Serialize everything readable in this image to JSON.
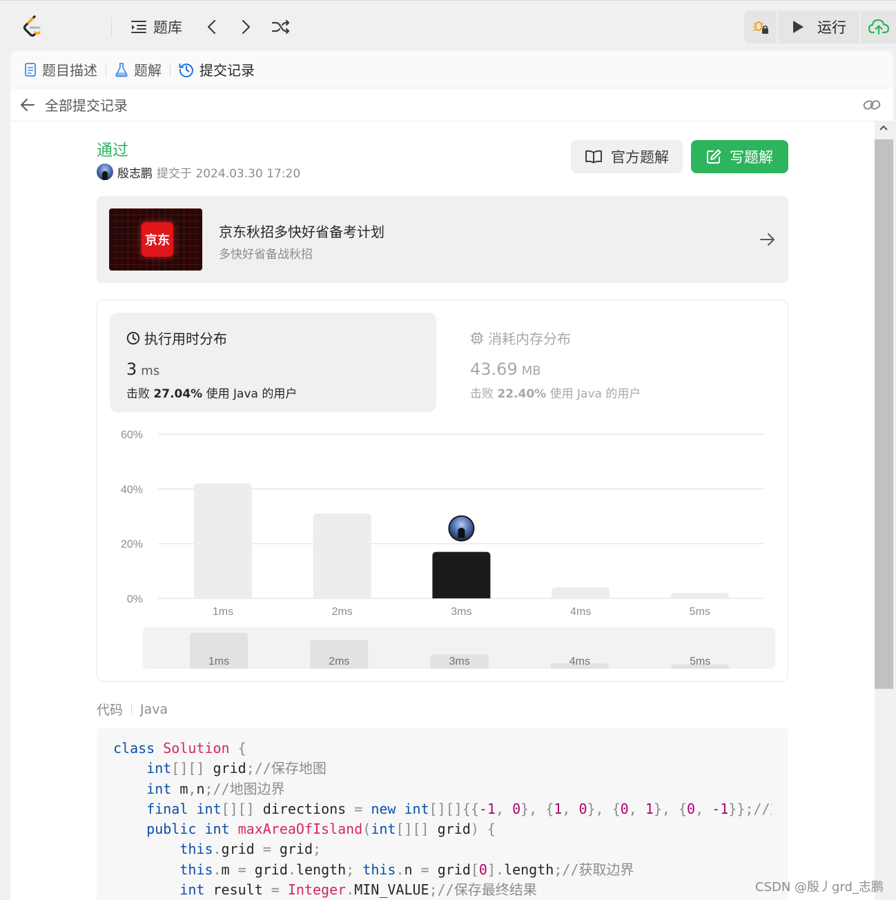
{
  "topbar": {
    "problem_bank_label": "题库",
    "run_label": "运行"
  },
  "tabs": [
    {
      "label": "题目描述"
    },
    {
      "label": "题解"
    },
    {
      "label": "提交记录"
    }
  ],
  "back_label": "全部提交记录",
  "submission": {
    "status": "通过",
    "username": "殷志鹏",
    "submitted_at": "提交于 2024.03.30 17:20"
  },
  "buttons": {
    "official_solution": "官方题解",
    "write_solution": "写题解"
  },
  "ad": {
    "badge": "京东",
    "title": "京东秋招多快好省备考计划",
    "subtitle": "多快好省备战秋招"
  },
  "runtime": {
    "title": "执行用时分布",
    "value": "3",
    "unit": "ms",
    "beat_prefix": "击败",
    "beat_pct": "27.04%",
    "beat_suffix": "使用 Java 的用户"
  },
  "memory": {
    "title": "消耗内存分布",
    "value": "43.69",
    "unit": "MB",
    "beat_prefix": "击败",
    "beat_pct": "22.40%",
    "beat_suffix": "使用 Java 的用户"
  },
  "chart_data": {
    "type": "bar",
    "categories": [
      "1ms",
      "2ms",
      "3ms",
      "4ms",
      "5ms"
    ],
    "values": [
      42,
      31,
      17,
      4,
      2
    ],
    "y_ticks": [
      "60%",
      "40%",
      "20%",
      "0%"
    ],
    "ylim": [
      0,
      60
    ],
    "highlight_index": 2,
    "grid": true,
    "colors": {
      "bar": "#ededed",
      "highlight": "#1a1a1a",
      "grid": "#e8e8e8",
      "tick": "#8c8c8c"
    },
    "overview_values": [
      100,
      80,
      40,
      15,
      12
    ]
  },
  "code": {
    "label": "代码",
    "language": "Java"
  },
  "watermark": "CSDN @殷丿grd_志鹏",
  "colors": {
    "accepted": "#2db55d",
    "write_button": "#2db55d",
    "link_blue": "#1a73e8"
  }
}
